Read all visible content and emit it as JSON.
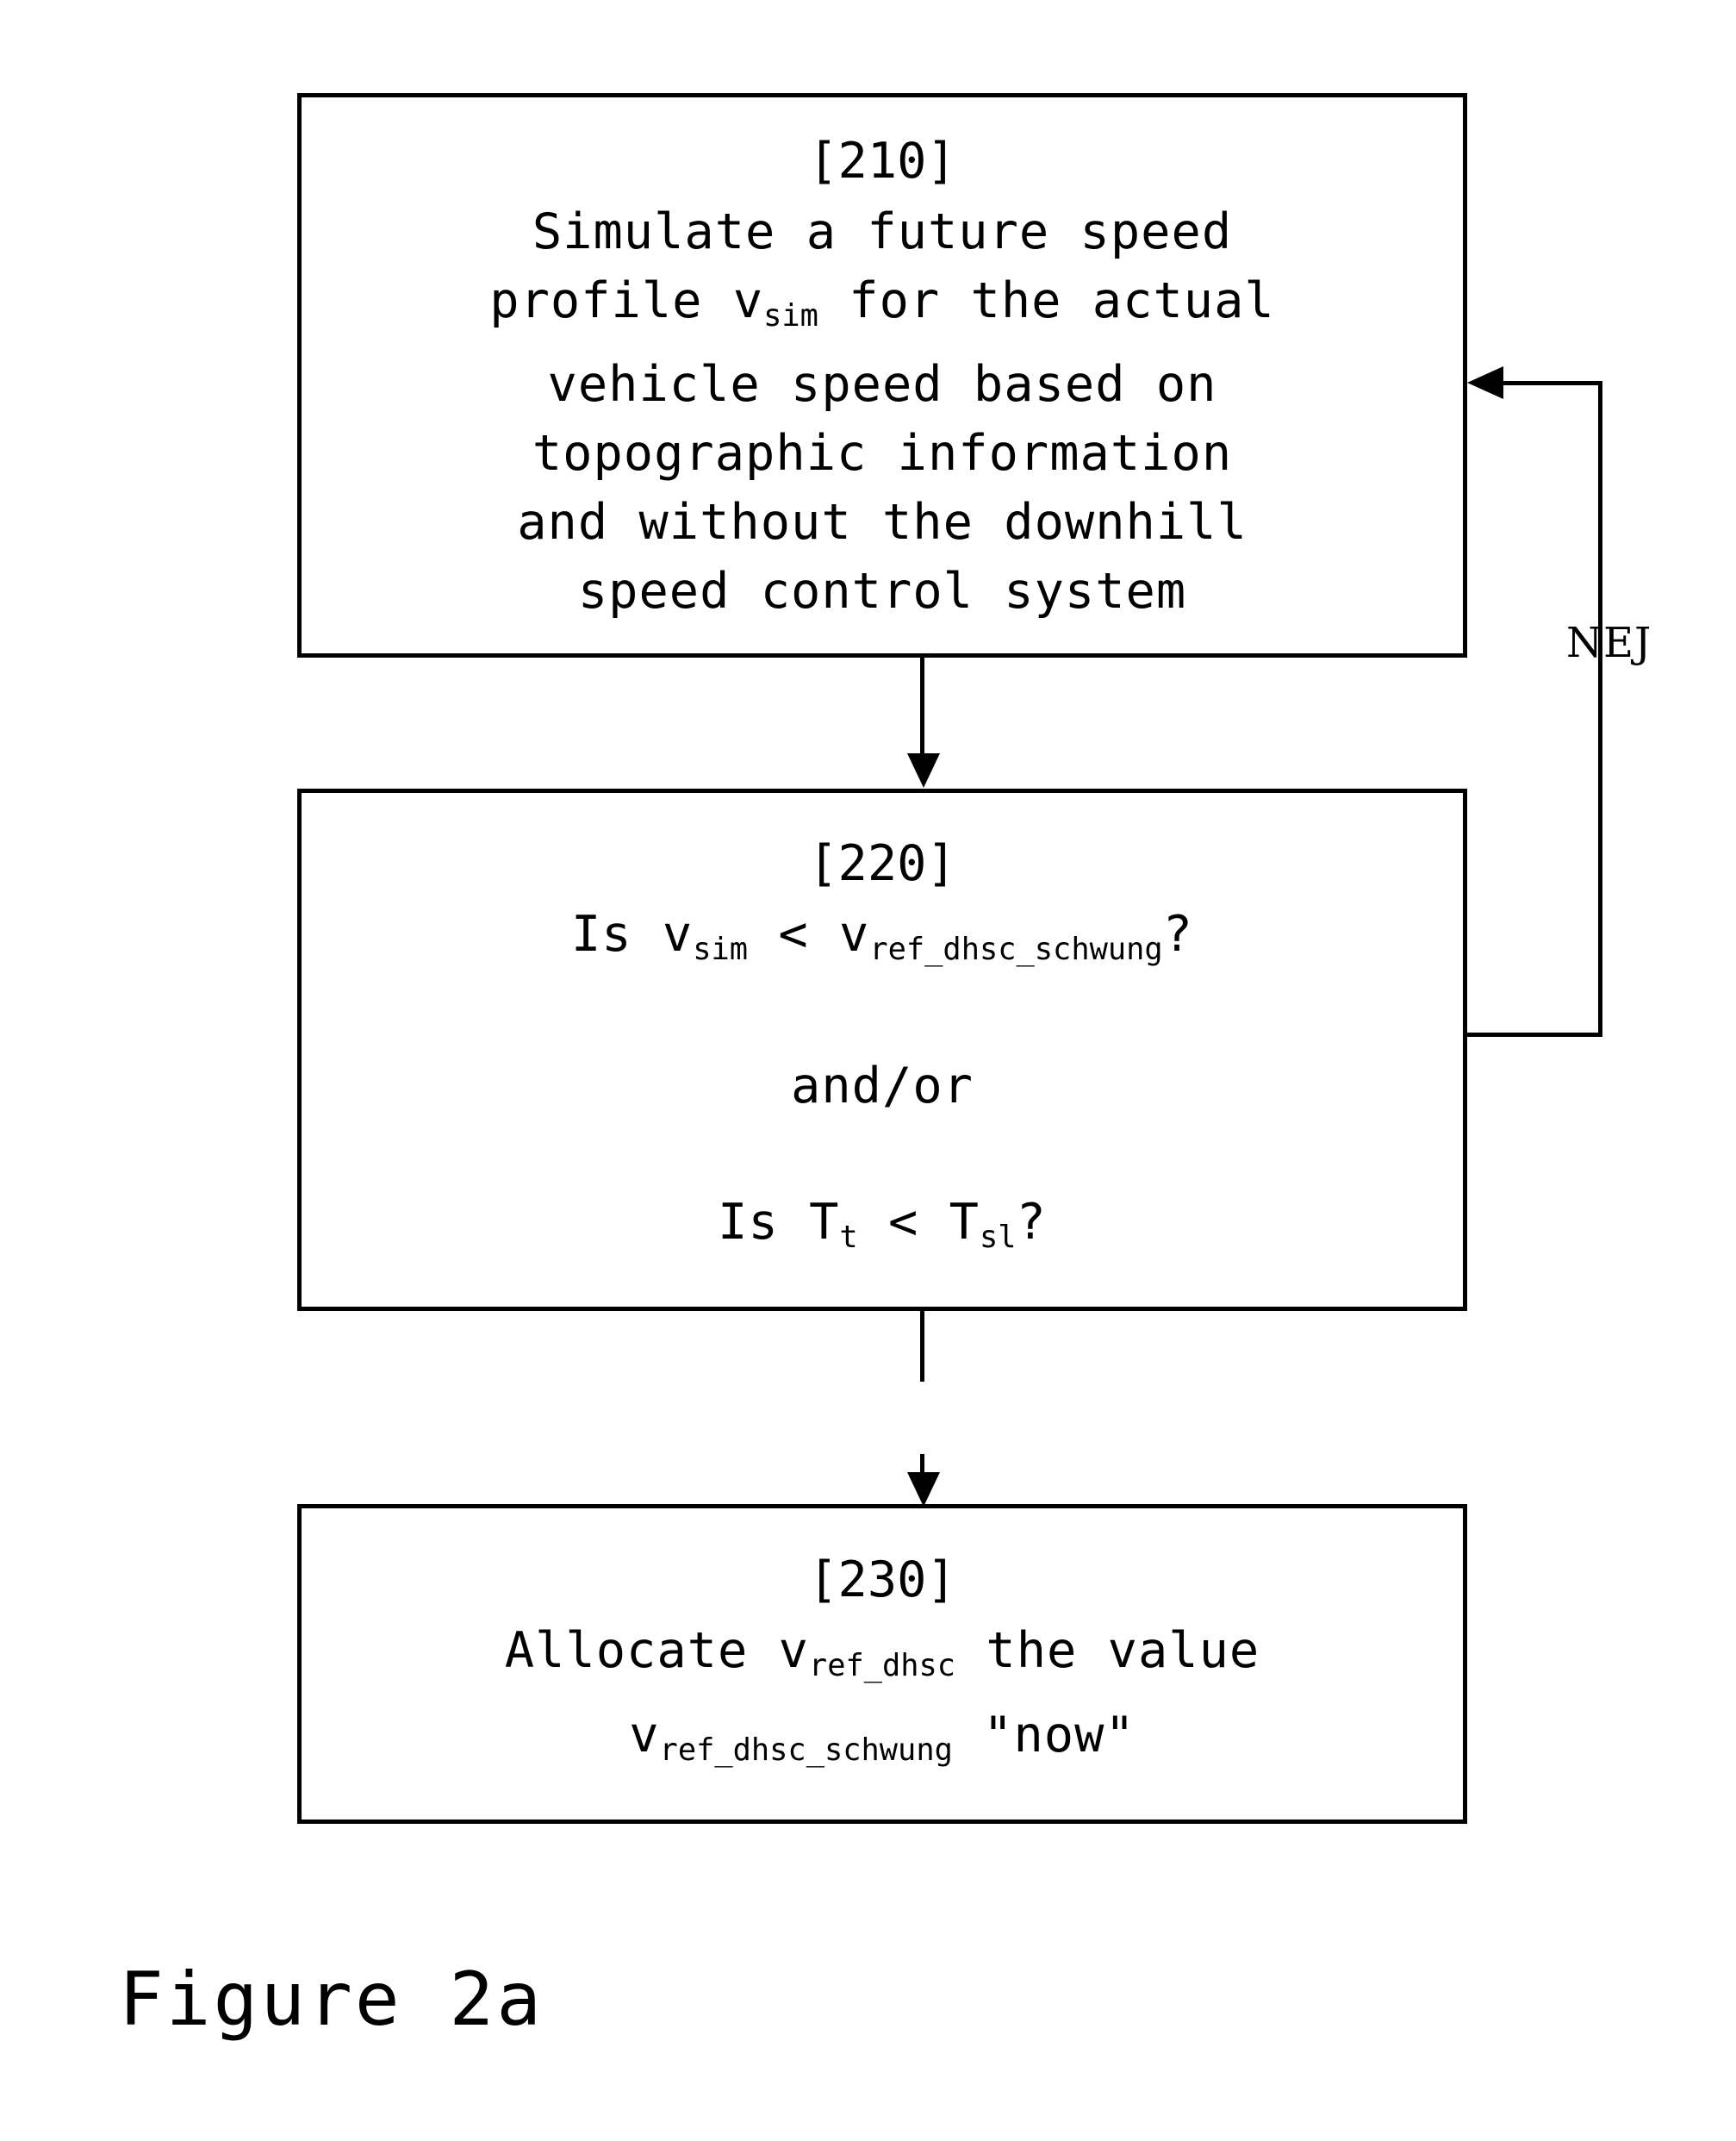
{
  "figure": {
    "caption": "Figure 2a",
    "loop_label": "NEJ"
  },
  "boxes": [
    {
      "id": "210",
      "ref": "[210]",
      "lines": [
        "Simulate a future speed",
        "profile v",
        "sim",
        " for the actual",
        "vehicle speed based on",
        "topographic information",
        "and without the downhill",
        "speed control system"
      ],
      "line1": "Simulate a future speed",
      "line2_a": "profile v",
      "line2_sub": "sim",
      "line2_b": " for the actual",
      "line3": "vehicle speed based on",
      "line4": "topographic information",
      "line5": "and without the downhill",
      "line6": "speed control system"
    },
    {
      "id": "220",
      "ref": "[220]",
      "cond1_a": "Is v",
      "cond1_sub1": "sim",
      "cond1_b": " < v",
      "cond1_sub2": "ref_dhsc_schwung",
      "cond1_c": "?",
      "conjunction": "and/or",
      "cond2_a": "Is T",
      "cond2_sub1": "t",
      "cond2_b": " < T",
      "cond2_sub2": "sl",
      "cond2_c": "?"
    },
    {
      "id": "230",
      "ref": "[230]",
      "line1_a": "Allocate v",
      "line1_sub": "ref_dhsc",
      "line1_b": " the value",
      "line2_a": "v",
      "line2_sub": "ref_dhsc_schwung",
      "line2_b": " \"now\""
    }
  ],
  "colors": {
    "ink": "#000000",
    "paper": "#ffffff"
  }
}
